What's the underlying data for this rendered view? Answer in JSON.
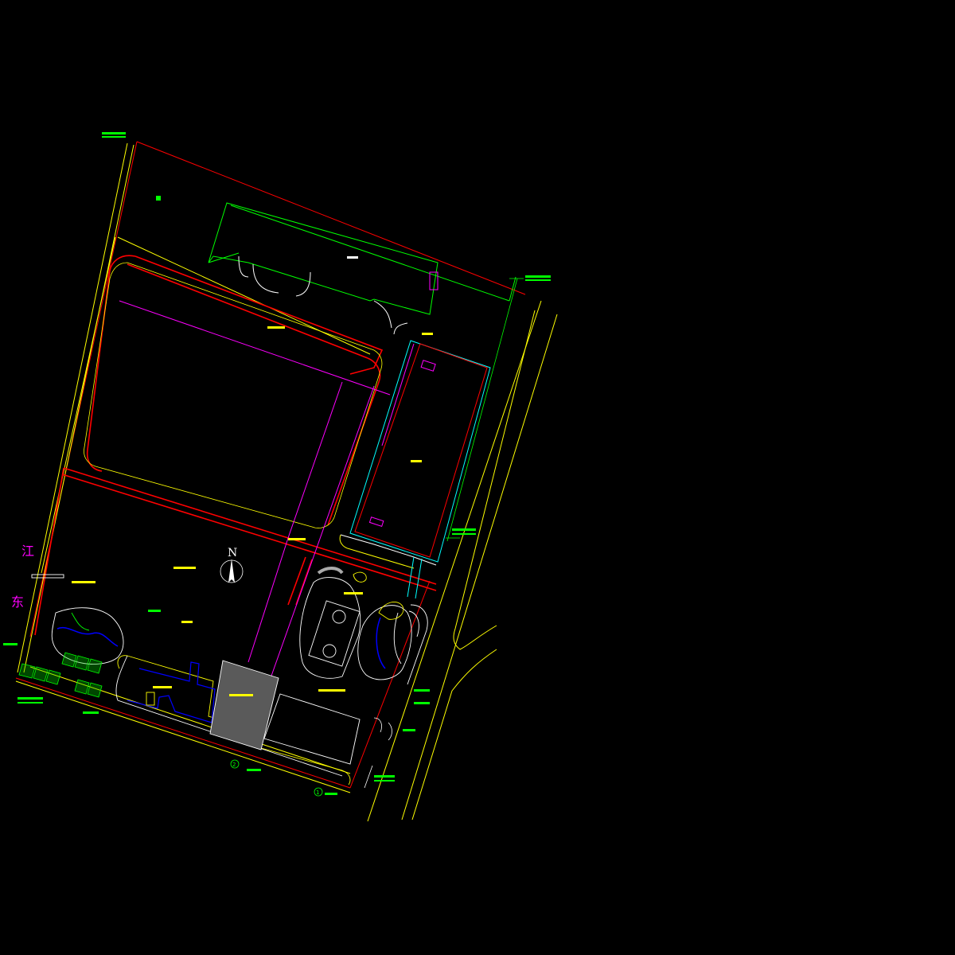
{
  "drawing": {
    "north_label": "N",
    "side_labels": [
      "江",
      "东"
    ],
    "callout_numbers": [
      "1",
      "2"
    ]
  },
  "colors": {
    "background": "#000000",
    "property_line": "#ff0000",
    "road_line": "#ffff00",
    "building_outline": "#00ff00",
    "axis_line": "#ff00ff",
    "garden_line": "#ffffff",
    "water": "#0000ff",
    "paving": "#aaaaaa"
  }
}
